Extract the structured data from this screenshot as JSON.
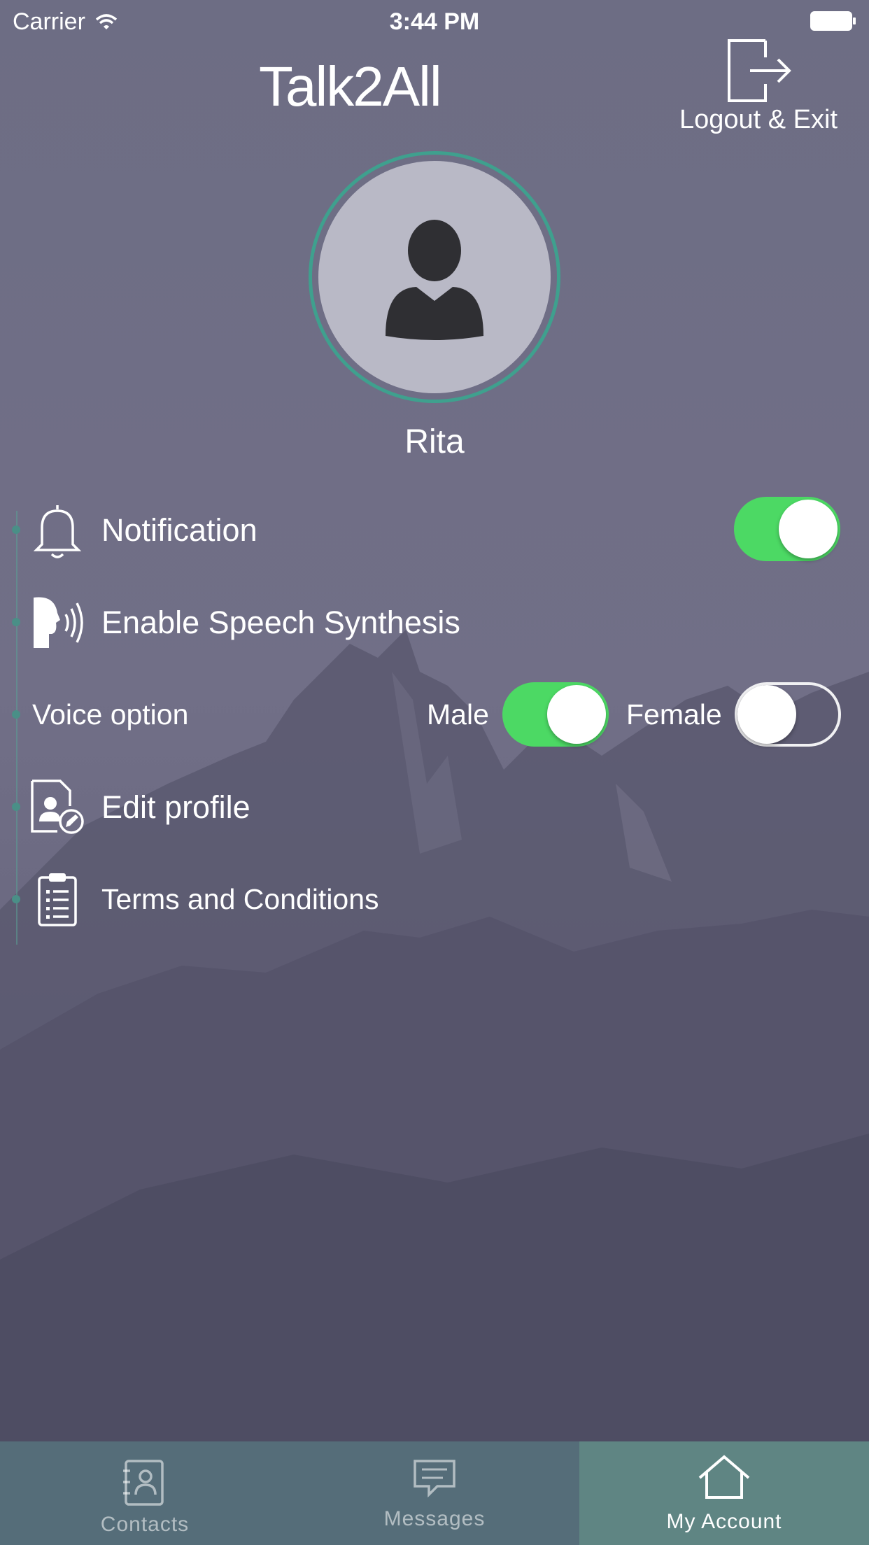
{
  "status_bar": {
    "carrier": "Carrier",
    "time": "3:44 PM"
  },
  "header": {
    "app_title": "Talk2All",
    "logout_label": "Logout & Exit"
  },
  "profile": {
    "name": "Rita"
  },
  "settings": {
    "notification": {
      "label": "Notification",
      "enabled": true
    },
    "speech": {
      "label": "Enable Speech Synthesis"
    },
    "voice": {
      "label": "Voice option",
      "male_label": "Male",
      "male_on": true,
      "female_label": "Female",
      "female_on": false
    },
    "edit_profile": {
      "label": "Edit profile"
    },
    "terms": {
      "label": "Terms and Conditions"
    }
  },
  "tabs": [
    {
      "label": "Contacts",
      "icon": "contacts-icon",
      "active": false
    },
    {
      "label": "Messages",
      "icon": "messages-icon",
      "active": false
    },
    {
      "label": "My Account",
      "icon": "home-icon",
      "active": true
    }
  ],
  "colors": {
    "accent_green": "#4cd964",
    "ring": "#3fa08e",
    "tab_active": "#5f8583"
  }
}
